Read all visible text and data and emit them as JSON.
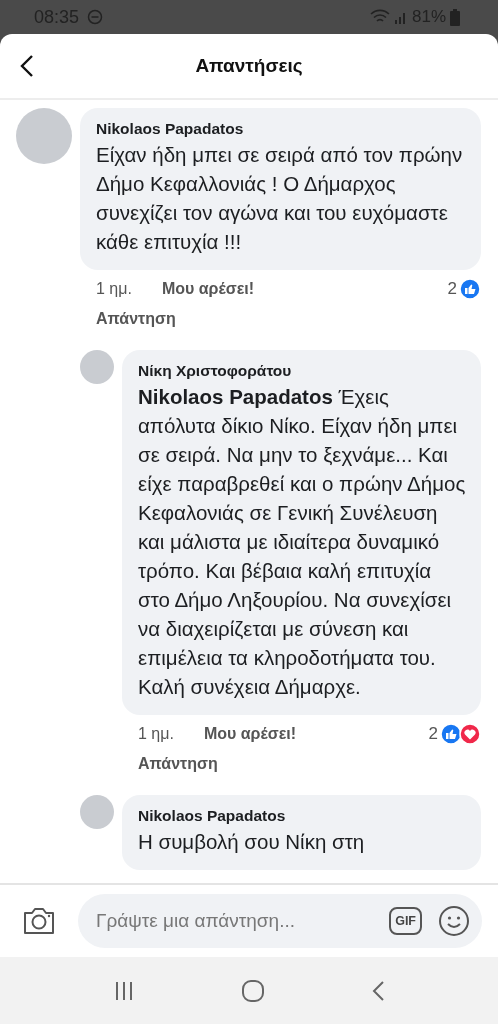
{
  "status_bar": {
    "time": "08:35",
    "battery": "81%"
  },
  "header": {
    "title": "Απαντήσεις"
  },
  "comments": [
    {
      "author": "Nikolaos Papadatos",
      "kind": "comment",
      "text": "Είχαν ήδη μπει σε σειρά από τον πρώην Δήμο Κεφαλλονιάς ! Ο Δήμαρχος συνεχίζει τον αγώνα και του ευχόμαστε κάθε επιτυχία !!!",
      "time": "1 ημ.",
      "like": "Μου αρέσει!",
      "reply": "Απάντηση",
      "reaction_count": "2",
      "reactions": [
        {
          "kind": "like"
        }
      ]
    },
    {
      "author": "Νίκη Χριστοφοράτου",
      "kind": "reply",
      "text": "**Nikolaos Papadatos** Έχεις απόλυτα δίκιο Νίκο. Είχαν ήδη μπει σε σειρά. Να μην το ξεχνάμε... Και είχε παραβρεθεί και ο πρώην Δήμος Κεφαλονιάς σε Γενική Συνέλευση και μάλιστα με ιδιαίτερα δυναμικό τρόπο. Και βέβαια καλή επιτυχία στο Δήμο Ληξουρίου. Να συνεχίσει να διαχειρίζεται με σύνεση και επιμέλεια τα κληροδοτήματα του. Καλή συνέχεια Δήμαρχε.",
      "time": "1 ημ.",
      "like": "Μου αρέσει!",
      "reply": "Απάντηση",
      "reaction_count": "2",
      "reactions": [
        {
          "kind": "like"
        },
        {
          "kind": "love"
        }
      ]
    },
    {
      "author": "Nikolaos Papadatos",
      "kind": "reply",
      "text": "Η συμβολή σου Νίκη στη"
    }
  ],
  "composer": {
    "placeholder": "Γράψτε μια απάντηση...",
    "gif_label": "GIF"
  }
}
